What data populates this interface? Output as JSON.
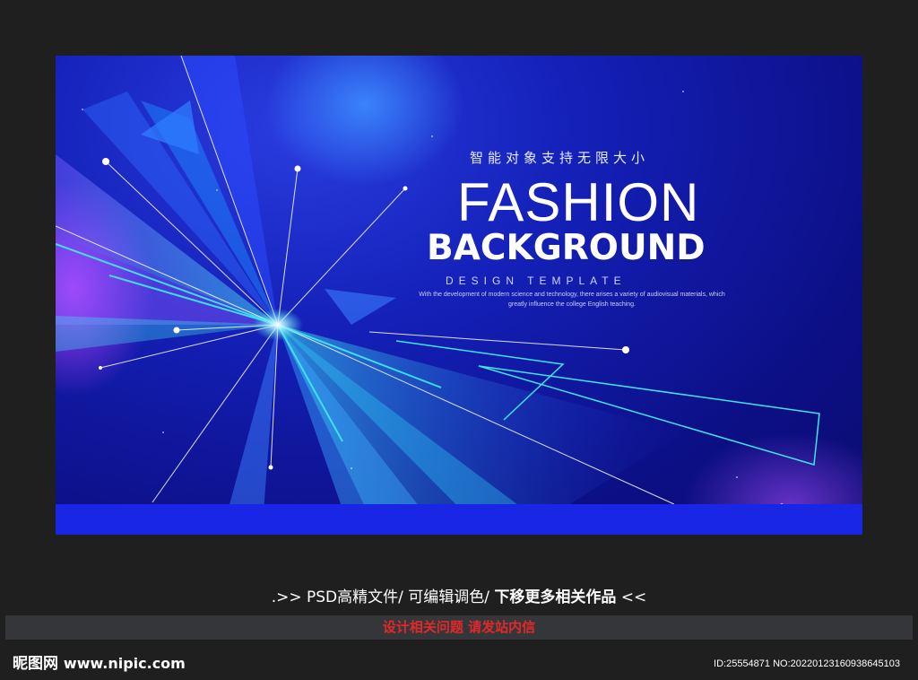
{
  "poster": {
    "tagline_cn": "智能对象支持无限大小",
    "title_line1": "FASHION",
    "title_line2": "BACKGROUND",
    "subtitle": "DESIGN TEMPLATE",
    "description": "With the development of modern science and technology, there arises a variety of audiovisual materials, which greatly influence the college English teaching.",
    "colors": {
      "background_dark": "#0c0f85",
      "background_mid": "#1420b8",
      "bottom_band": "#1a26e6",
      "cyan_line": "#3ee6f0",
      "purple_glow": "#b040ff"
    }
  },
  "footer": {
    "promo_prefix": ".>> PSD高精文件/  可编辑调色/ ",
    "promo_strong": "下移更多相关作品",
    "promo_suffix": " <<",
    "notice": "设计相关问题 请发站内信",
    "watermark_cn": "昵图网",
    "watermark_domain": "www.nipic.com",
    "image_id": "ID:25554871 NO:20220123160938645103"
  }
}
